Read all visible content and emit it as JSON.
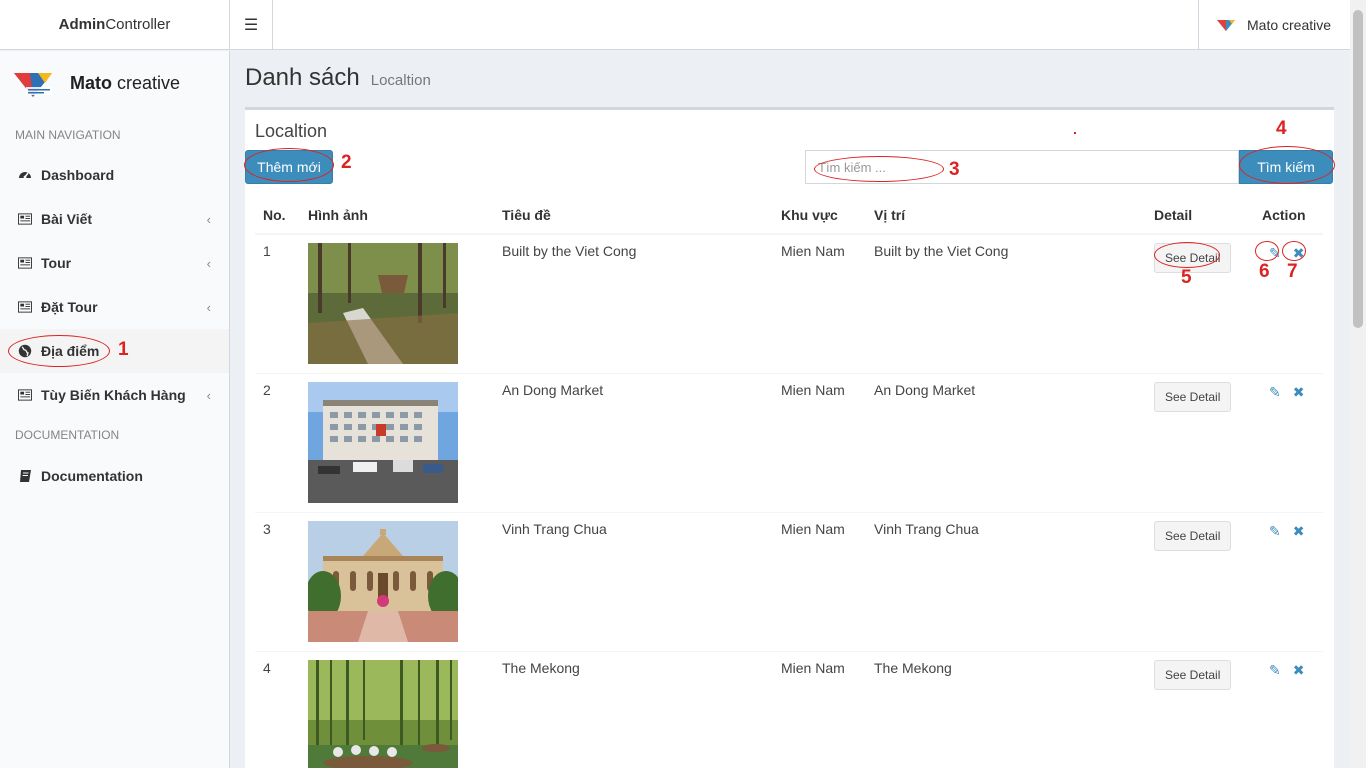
{
  "header": {
    "logo_bold": "Admin",
    "logo_rest": "Controller",
    "toggle_glyph": "☰",
    "user_name": "Mato creative"
  },
  "sidebar": {
    "brand_bold": "Mato",
    "brand_rest": " creative",
    "main_nav_header": "MAIN NAVIGATION",
    "items": [
      {
        "label": "Dashboard",
        "icon": "dashboard-icon",
        "has_chevron": false
      },
      {
        "label": "Bài Viết",
        "icon": "newspaper-icon",
        "has_chevron": true
      },
      {
        "label": "Tour",
        "icon": "newspaper-icon",
        "has_chevron": true
      },
      {
        "label": "Đặt Tour",
        "icon": "newspaper-icon",
        "has_chevron": true
      },
      {
        "label": "Địa điểm",
        "icon": "globe-icon",
        "has_chevron": false,
        "active": true
      },
      {
        "label": "Tùy Biến Khách Hàng",
        "icon": "newspaper-icon",
        "has_chevron": true
      }
    ],
    "doc_header": "DOCUMENTATION",
    "doc_item": "Documentation",
    "chevron_glyph": "‹"
  },
  "content": {
    "title": "Danh sách",
    "subtitle": "Localtion",
    "box_title": "Localtion",
    "add_button": "Thêm mới",
    "search_placeholder": "Tìm kiếm ...",
    "search_button": "Tìm kiếm"
  },
  "table": {
    "headers": [
      "No.",
      "Hình ảnh",
      "Tiêu đề",
      "Khu vực",
      "Vị trí",
      "Detail",
      "Action"
    ],
    "detail_label": "See Detail",
    "edit_glyph": "✎",
    "delete_glyph": "✖",
    "rows": [
      {
        "no": "1",
        "title": "Built by the Viet Cong",
        "region": "Mien Nam",
        "location": "Built by the Viet Cong",
        "image": "forest-trench-photo"
      },
      {
        "no": "2",
        "title": "An Dong Market",
        "region": "Mien Nam",
        "location": "An Dong Market",
        "image": "market-building-photo"
      },
      {
        "no": "3",
        "title": "Vinh Trang Chua",
        "region": "Mien Nam",
        "location": "Vinh Trang Chua",
        "image": "pagoda-photo"
      },
      {
        "no": "4",
        "title": "The Mekong",
        "region": "Mien Nam",
        "location": "The Mekong",
        "image": "mekong-boat-photo"
      }
    ]
  },
  "annotations": [
    "1",
    "2",
    "3",
    "4",
    "5",
    "6",
    "7"
  ],
  "colors": {
    "primary": "#3c8dbc",
    "annotation": "#dd2222",
    "sidebar_bg": "#f9fafc",
    "page_bg": "#ecf0f5"
  }
}
